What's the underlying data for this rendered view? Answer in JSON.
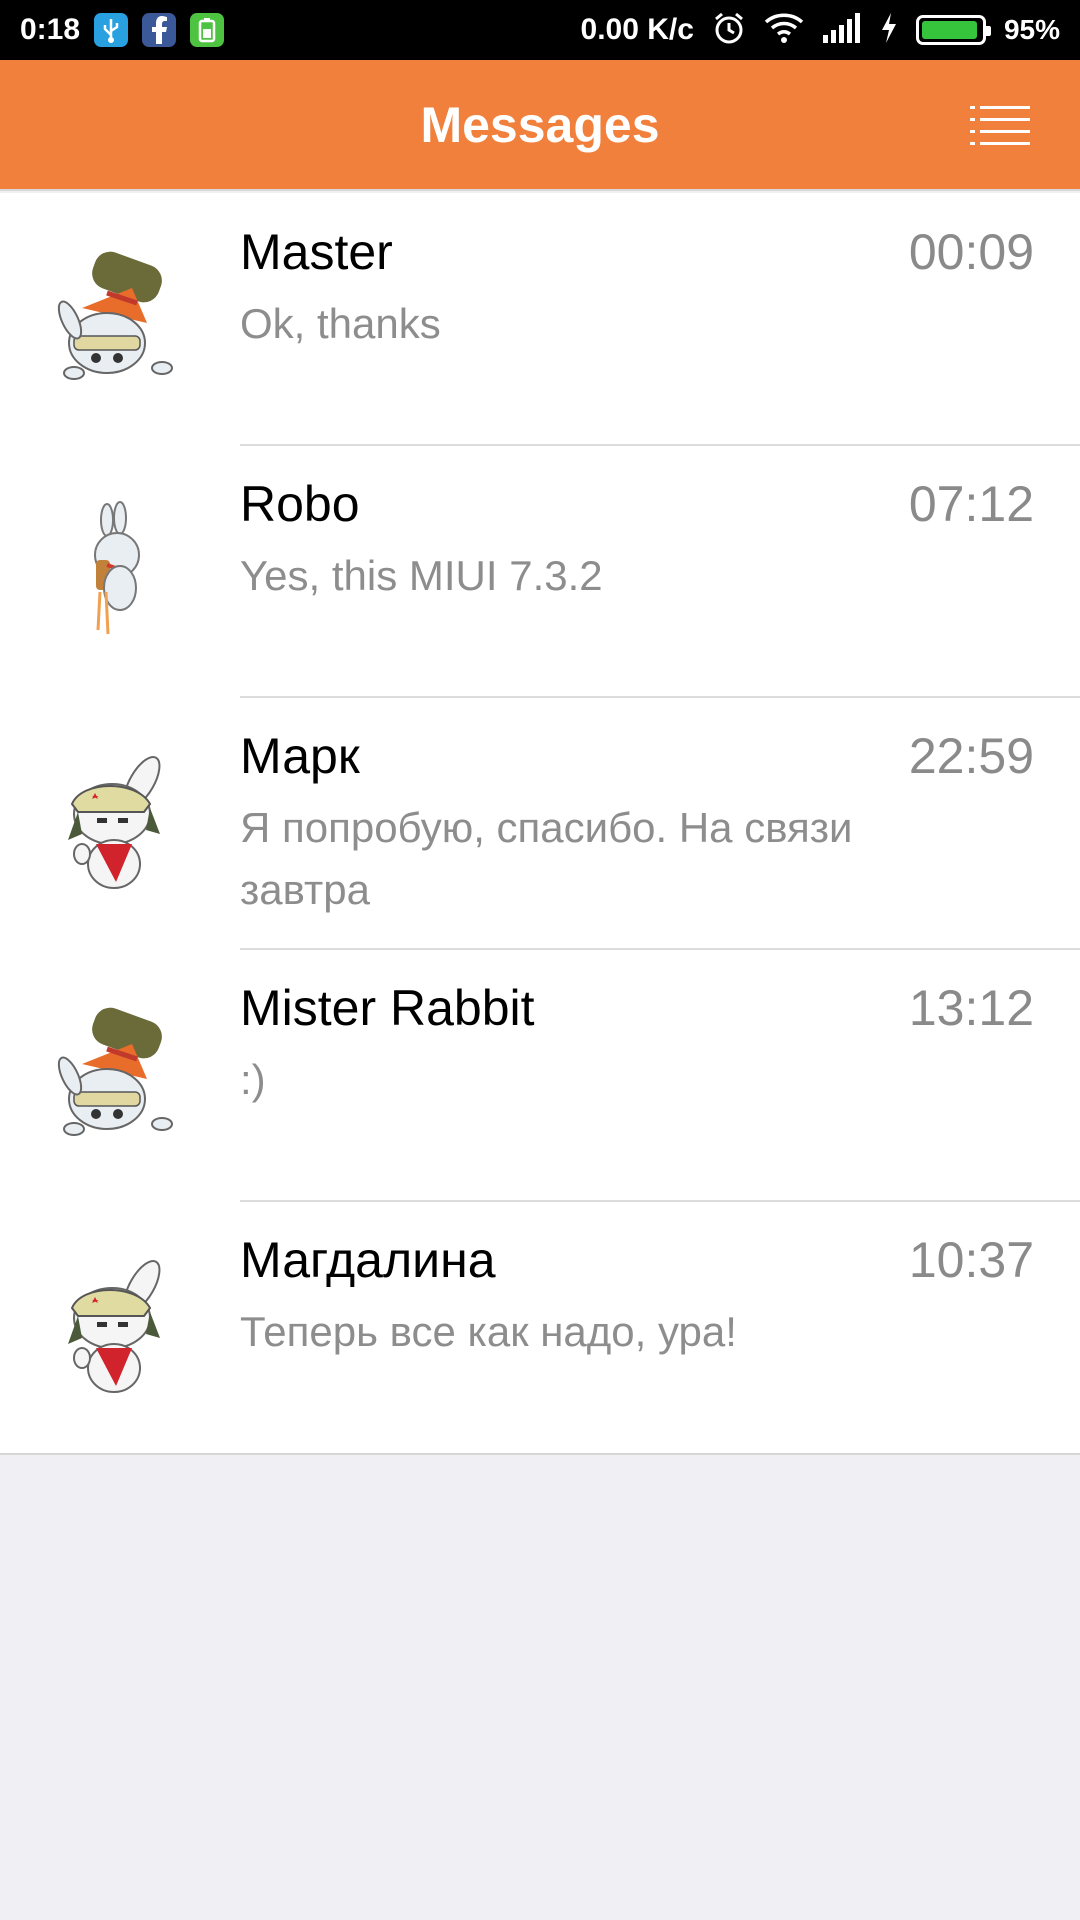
{
  "status_bar": {
    "time": "0:18",
    "speed": "0.00 K/c",
    "battery_percent": "95%",
    "battery_level": 0.95,
    "icons": [
      "usb-icon",
      "facebook-icon",
      "battery-app-icon",
      "alarm-icon",
      "wifi-icon",
      "signal-icon",
      "charging-icon",
      "battery-icon"
    ]
  },
  "header": {
    "title": "Messages",
    "menu_icon": "list-menu-icon",
    "color": "#f0803c"
  },
  "conversations": [
    {
      "name": "Master",
      "time": "00:09",
      "preview": "Ok, thanks",
      "avatar": "rabbit-handstand"
    },
    {
      "name": "Robo",
      "time": "07:12",
      "preview": "Yes, this MIUI 7.3.2",
      "avatar": "rabbit-rocket"
    },
    {
      "name": "Марк",
      "time": "22:59",
      "preview": "Я попробую, спасибо. На связи завтра",
      "avatar": "rabbit-ushanka"
    },
    {
      "name": "Mister Rabbit",
      "time": "13:12",
      "preview": ":)",
      "avatar": "rabbit-handstand"
    },
    {
      "name": "Магдалина",
      "time": "10:37",
      "preview": "Теперь все как надо, ура!",
      "avatar": "rabbit-ushanka"
    }
  ]
}
